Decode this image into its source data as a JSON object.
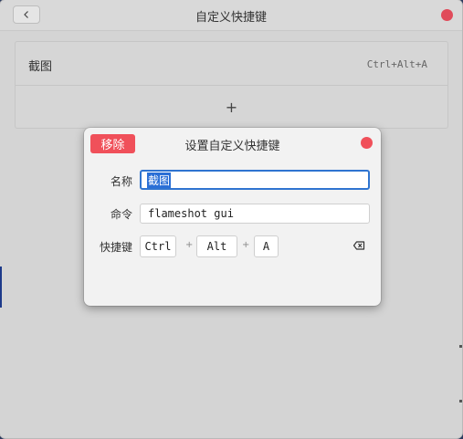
{
  "window": {
    "title": "自定义快捷键"
  },
  "shortcuts": [
    {
      "name": "截图",
      "keys": "Ctrl+Alt+A"
    }
  ],
  "add_label": "+",
  "dialog": {
    "remove_label": "移除",
    "title": "设置自定义快捷键",
    "name_label": "名称",
    "name_value": "截图",
    "command_label": "命令",
    "command_value": "flameshot gui",
    "shortcut_label": "快捷键",
    "keys": [
      "Ctrl",
      "Alt",
      "A"
    ],
    "separator": "+"
  },
  "colors": {
    "accent_red": "#f0505a",
    "focus_blue": "#2f74d0",
    "selection_blue": "#2a6fd6"
  },
  "icons": {
    "back": "chevron-left-icon",
    "close": "close-dot-icon",
    "backspace": "backspace-icon"
  }
}
